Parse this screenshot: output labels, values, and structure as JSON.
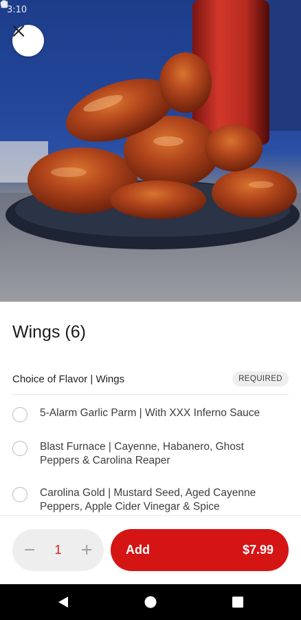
{
  "status_bar": {
    "time": "3:10",
    "icons": [
      "settings-gear-icon",
      "shield-icon",
      "wifi-icon",
      "signal-icon",
      "battery-icon"
    ]
  },
  "hero": {
    "image_subject": "wings-photo",
    "close_icon": "close-icon"
  },
  "item": {
    "title": "Wings (6)"
  },
  "modifier_group": {
    "title": "Choice of Flavor | Wings",
    "badge": "REQUIRED",
    "options": [
      {
        "label": "5-Alarm Garlic Parm | With XXX Inferno Sauce",
        "selected": false
      },
      {
        "label": "Blast Furnace | Cayenne, Habanero, Ghost Peppers & Carolina Reaper",
        "selected": false
      },
      {
        "label": "Carolina Gold | Mustard Seed, Aged Cayenne Peppers, Apple Cider Vinegar & Spice",
        "selected": false
      }
    ]
  },
  "footer": {
    "quantity": "1",
    "minus_symbol": "−",
    "plus_symbol": "+",
    "add_label": "Add",
    "price": "$7.99"
  },
  "nav_bar": {
    "icons": [
      "back-triangle-icon",
      "home-circle-icon",
      "recents-square-icon"
    ]
  },
  "colors": {
    "accent": "#d51414",
    "quantity_text": "#d81b1b",
    "pill_background": "#eeeeee"
  }
}
